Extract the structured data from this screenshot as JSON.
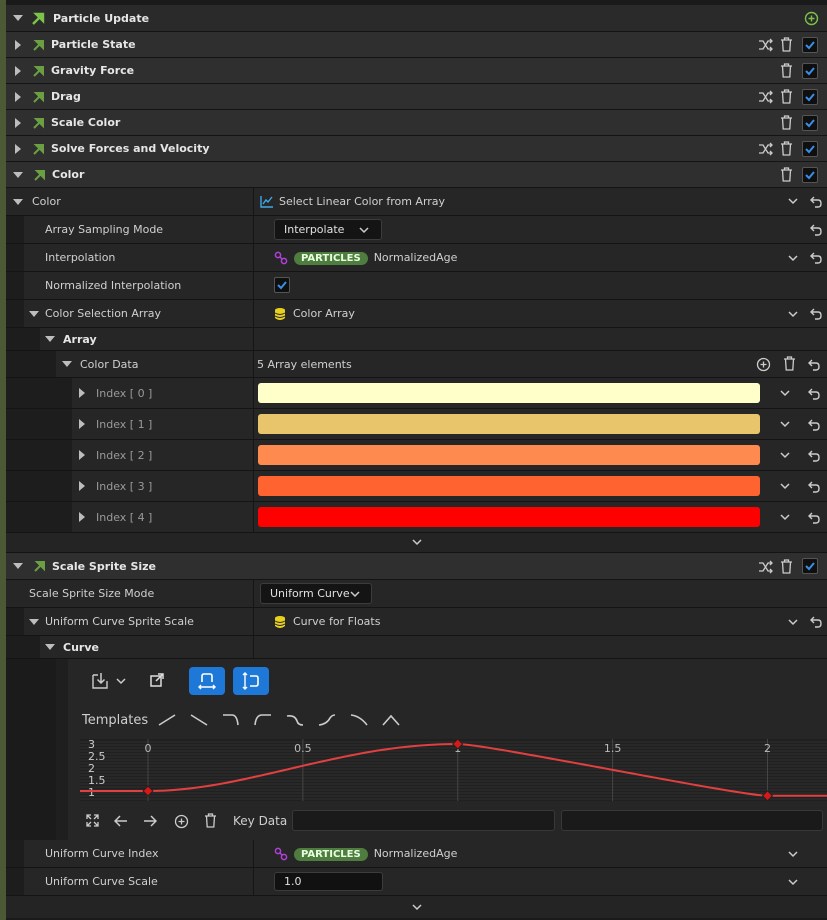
{
  "particle_update": {
    "title": "Particle Update"
  },
  "modules": [
    {
      "label": "Particle State"
    },
    {
      "label": "Gravity Force"
    },
    {
      "label": "Drag"
    },
    {
      "label": "Scale Color"
    },
    {
      "label": "Solve Forces and Velocity"
    },
    {
      "label": "Color"
    }
  ],
  "color_section": {
    "prop_label": "Color",
    "prop_value": "Select Linear Color from Array",
    "array_sampling_mode": {
      "label": "Array Sampling Mode",
      "value": "Interpolate"
    },
    "interpolation": {
      "label": "Interpolation",
      "badge": "PARTICLES",
      "value": "NormalizedAge"
    },
    "normalized_interpolation": {
      "label": "Normalized Interpolation",
      "checked": true
    },
    "color_selection_array": {
      "label": "Color Selection Array",
      "value": "Color Array"
    },
    "array_label": "Array",
    "color_data": {
      "label": "Color Data",
      "summary": "5 Array elements"
    },
    "indices": [
      {
        "label": "Index [ 0 ]",
        "color": "#ffffc9"
      },
      {
        "label": "Index [ 1 ]",
        "color": "#e8c46a"
      },
      {
        "label": "Index [ 2 ]",
        "color": "#ff8a4f"
      },
      {
        "label": "Index [ 3 ]",
        "color": "#ff6330"
      },
      {
        "label": "Index [ 4 ]",
        "color": "#ff0000"
      }
    ]
  },
  "scale_sprite": {
    "title": "Scale Sprite Size",
    "mode": {
      "label": "Scale Sprite Size Mode",
      "value": "Uniform Curve"
    },
    "curve_scale": {
      "label": "Uniform Curve Sprite Scale",
      "value": "Curve for Floats"
    },
    "curve_label": "Curve",
    "templates_label": "Templates",
    "key_data_label": "Key Data",
    "curve_x_ticks": [
      "0",
      "0.5",
      "1",
      "1.5",
      "2"
    ],
    "curve_y_ticks": [
      "3",
      "2.5",
      "2",
      "1.5",
      "1"
    ],
    "curve_keys": [
      {
        "time": 0.0,
        "value": 1.0
      },
      {
        "time": 1.0,
        "value": 3.0
      },
      {
        "time": 2.0,
        "value": 0.8
      }
    ],
    "curve_index": {
      "label": "Uniform Curve Index",
      "badge": "PARTICLES",
      "value": "NormalizedAge"
    },
    "curve_index_scale": {
      "label": "Uniform Curve Scale",
      "value": "1.0"
    }
  },
  "colors": {
    "accent_blue": "#1e78d8",
    "check_blue": "#3a8ee6",
    "particles_badge": "#4e7d3f",
    "curve_red": "#e04040"
  }
}
